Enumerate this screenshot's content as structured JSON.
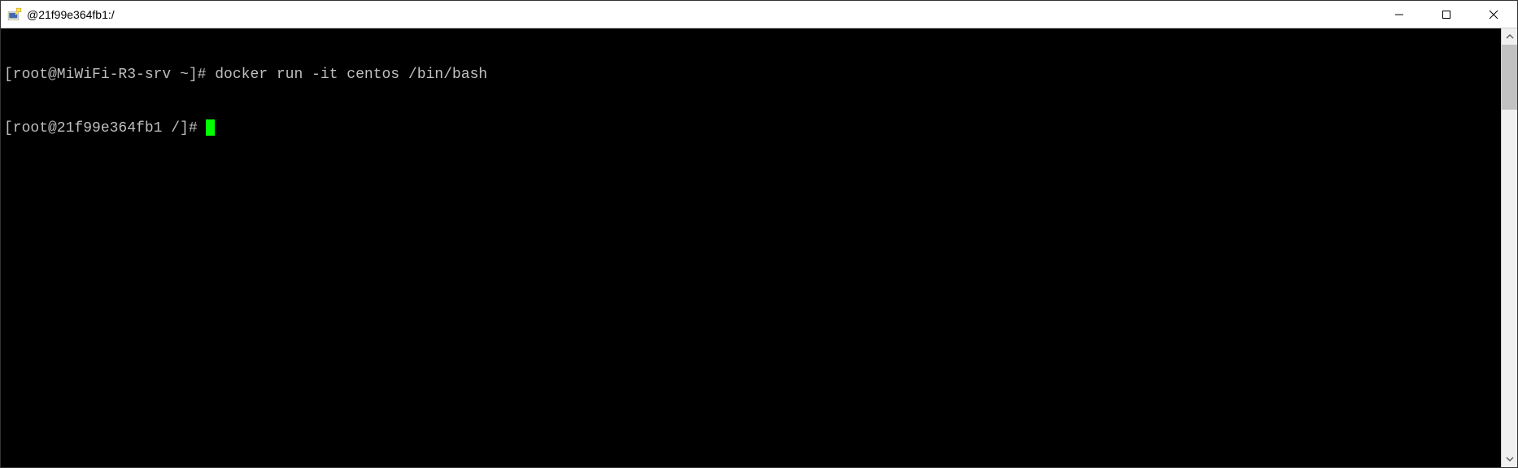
{
  "window": {
    "title": "@21f99e364fb1:/"
  },
  "terminal": {
    "lines": [
      {
        "prompt": "[root@MiWiFi-R3-srv ~]# ",
        "command": "docker run -it centos /bin/bash"
      },
      {
        "prompt": "[root@21f99e364fb1 /]# ",
        "command": "",
        "cursor": true
      }
    ]
  },
  "colors": {
    "terminal_bg": "#000000",
    "terminal_fg": "#bfbfbf",
    "cursor": "#00ff00"
  }
}
